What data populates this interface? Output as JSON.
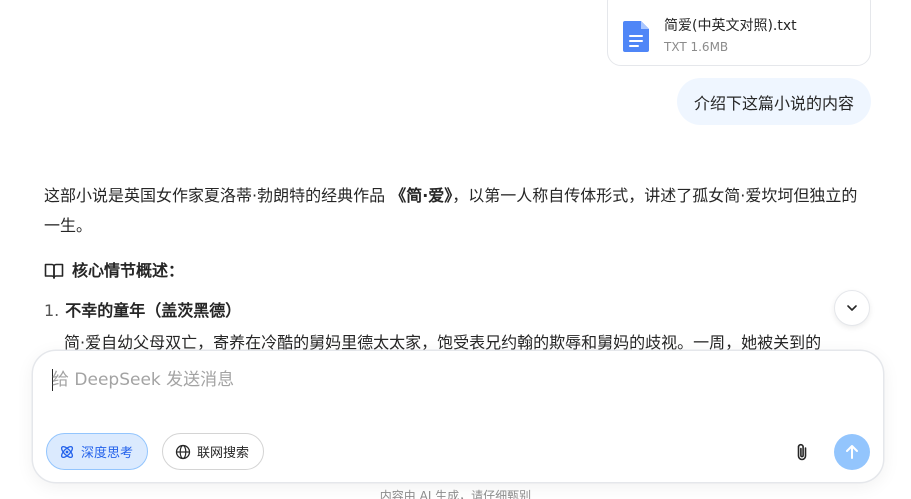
{
  "attachment": {
    "name": "简爱(中英文对照).txt",
    "meta": "TXT 1.6MB",
    "icon": "document-icon"
  },
  "user_message": "介绍下这篇小说的内容",
  "answer": {
    "intro_before": "这部小说是英国女作家夏洛蒂·勃朗特的经典作品 ",
    "intro_book": "《简·爱》",
    "intro_after": "，以第一人称自传体形式，讲述了孤女简·爱坎坷但独立的一生。",
    "section_heading": "核心情节概述：",
    "items": [
      {
        "num": "1.",
        "title": "不幸的童年（盖茨黑德）"
      }
    ],
    "cut_line": "简·爱自幼父母双亡，寄养在冷酷的舅妈里德太太家，饱受表兄约翰的欺辱和舅妈的歧视。一周，她被关到的"
  },
  "composer": {
    "placeholder": "给 DeepSeek 发送消息",
    "deep_think_label": "深度思考",
    "web_search_label": "联网搜索"
  },
  "footer": "内容由 AI 生成，请仔细甄别",
  "colors": {
    "accent": "#2563eb",
    "accent_light": "#dbeafe",
    "send_disabled": "#93c5fd",
    "bubble": "#eff6ff"
  }
}
